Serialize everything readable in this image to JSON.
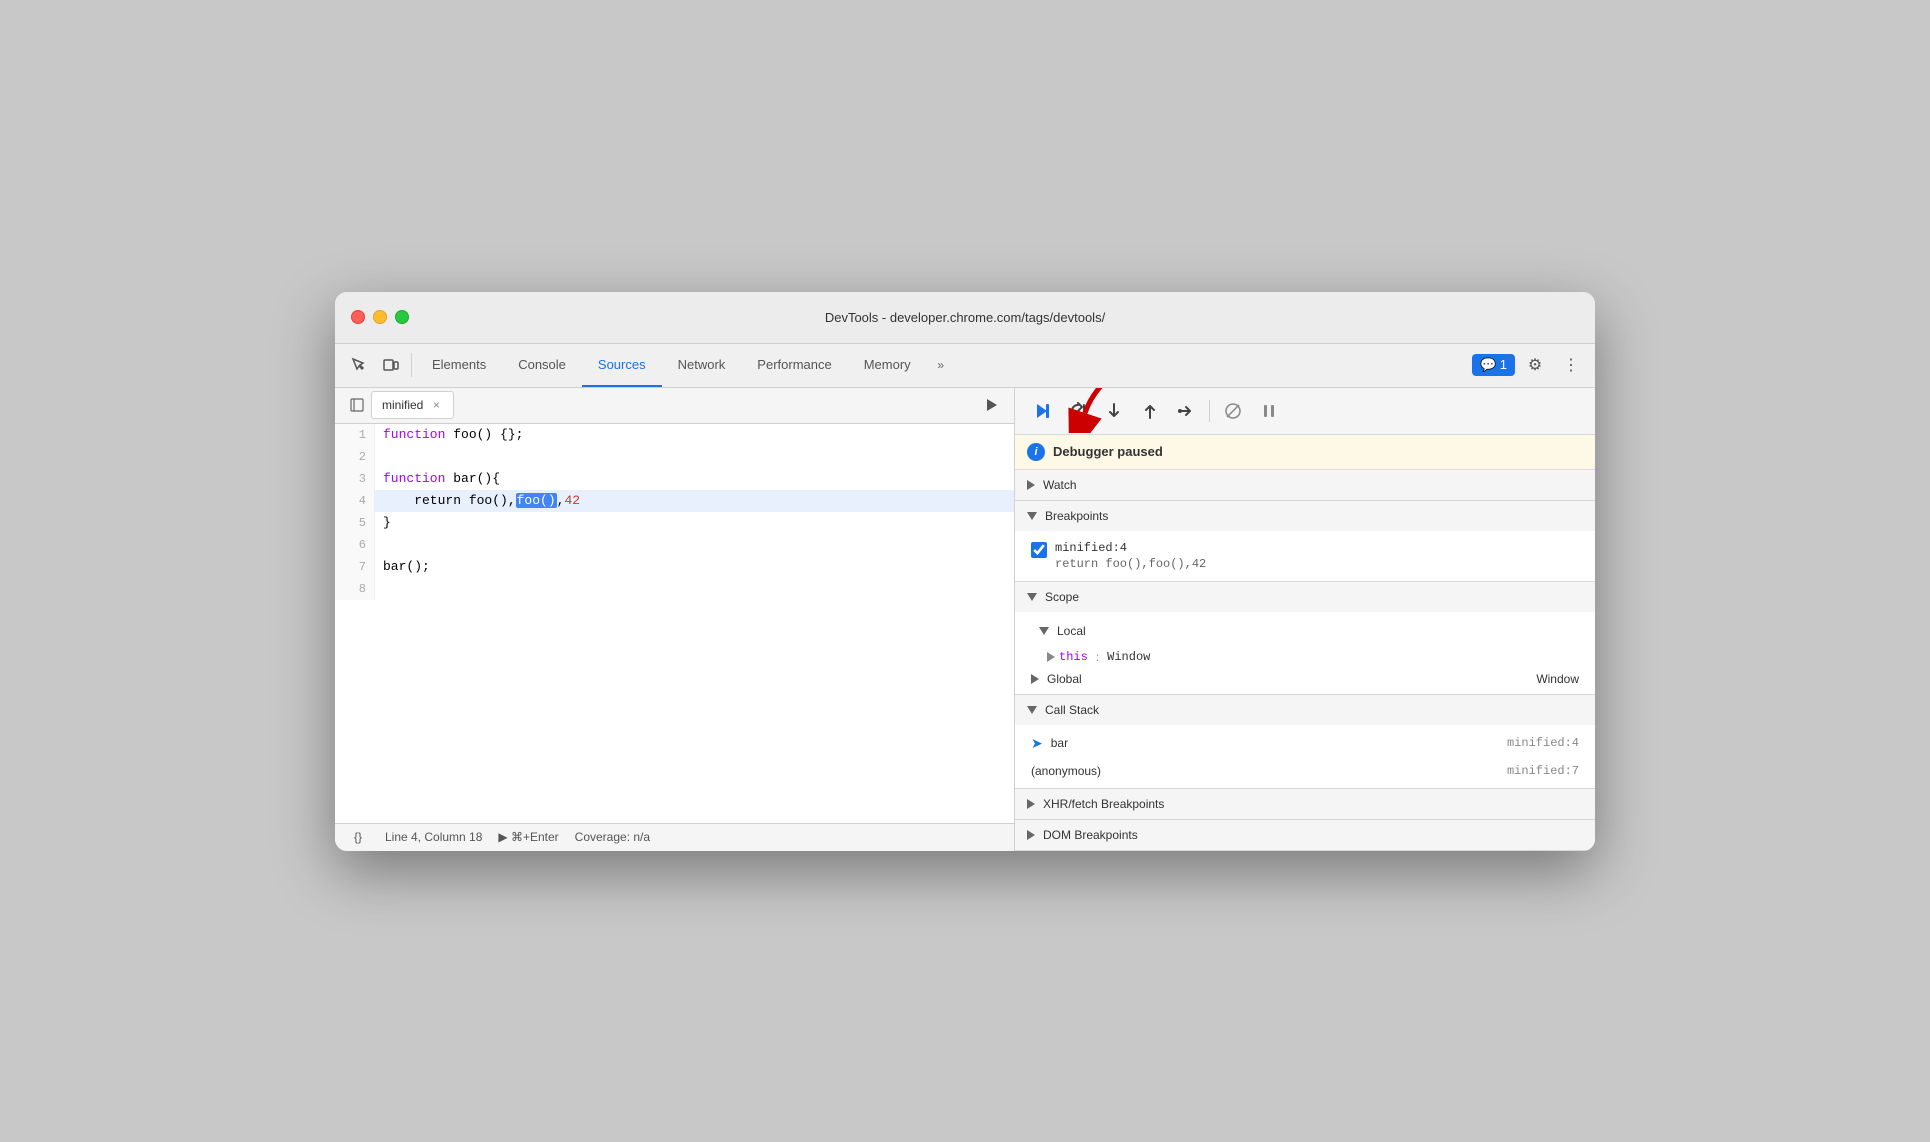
{
  "window": {
    "title": "DevTools - developer.chrome.com/tags/devtools/"
  },
  "toolbar": {
    "tabs": [
      {
        "label": "Elements",
        "active": false
      },
      {
        "label": "Console",
        "active": false
      },
      {
        "label": "Sources",
        "active": true
      },
      {
        "label": "Network",
        "active": false
      },
      {
        "label": "Performance",
        "active": false
      },
      {
        "label": "Memory",
        "active": false
      }
    ],
    "overflow_label": "»",
    "badge_label": "💬 1",
    "settings_icon": "⚙",
    "more_icon": "⋮"
  },
  "file_panel": {
    "file_tab_name": "minified",
    "run_icon": "▶"
  },
  "code": {
    "lines": [
      {
        "num": 1,
        "content": "function foo() {};",
        "highlighted": false
      },
      {
        "num": 2,
        "content": "",
        "highlighted": false
      },
      {
        "num": 3,
        "content": "function bar(){",
        "highlighted": false
      },
      {
        "num": 4,
        "content": "    return foo(),foo(),42",
        "highlighted": true
      },
      {
        "num": 5,
        "content": "}",
        "highlighted": false
      },
      {
        "num": 6,
        "content": "",
        "highlighted": false
      },
      {
        "num": 7,
        "content": "bar();",
        "highlighted": false
      },
      {
        "num": 8,
        "content": "",
        "highlighted": false
      }
    ]
  },
  "status_bar": {
    "format_icon": "{}",
    "position": "Line 4, Column 18",
    "run_label": "⌘+Enter",
    "coverage": "Coverage: n/a"
  },
  "debugger": {
    "paused_message": "Debugger paused",
    "sections": {
      "watch": {
        "label": "Watch",
        "expanded": false
      },
      "breakpoints": {
        "label": "Breakpoints",
        "expanded": true,
        "items": [
          {
            "location": "minified:4",
            "code": "return foo(),foo(),42"
          }
        ]
      },
      "scope": {
        "label": "Scope",
        "expanded": true,
        "local": {
          "label": "Local",
          "this_key": "this",
          "this_val": "Window"
        },
        "global": {
          "label": "Global",
          "value": "Window"
        }
      },
      "call_stack": {
        "label": "Call Stack",
        "expanded": true,
        "items": [
          {
            "name": "bar",
            "location": "minified:4"
          },
          {
            "name": "(anonymous)",
            "location": "minified:7"
          }
        ]
      },
      "xhr_breakpoints": {
        "label": "XHR/fetch Breakpoints",
        "expanded": false
      },
      "dom_breakpoints": {
        "label": "DOM Breakpoints",
        "expanded": false
      }
    }
  },
  "debug_toolbar": {
    "resume_icon": "▶",
    "step_over_icon": "↩",
    "step_into_icon": "↓",
    "step_out_icon": "↑",
    "step_icon": "→",
    "deactivate_icon": "⧸",
    "pause_on_exception_icon": "⏸"
  }
}
